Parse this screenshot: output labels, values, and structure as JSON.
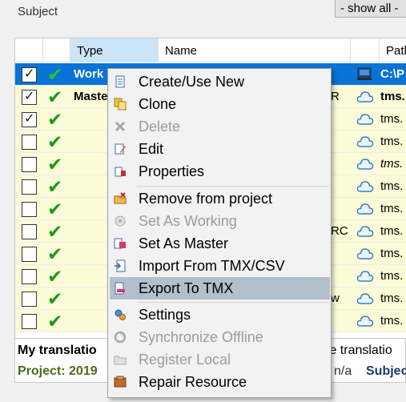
{
  "subject_label": "Subject",
  "show_all_label": "- show all -",
  "columns": {
    "type": "Type",
    "name": "Name",
    "path": "Path"
  },
  "rows": [
    {
      "checked": true,
      "type": "Work",
      "name": "",
      "path": "C:\\P",
      "selected": true,
      "location": "computer"
    },
    {
      "checked": true,
      "type": "Maste",
      "name": "R",
      "path": "tms.",
      "selected": false,
      "location": "cloud"
    },
    {
      "checked": true,
      "type": "",
      "name": "",
      "path": "tms.",
      "selected": false,
      "location": "cloud"
    },
    {
      "checked": false,
      "type": "",
      "name": "",
      "path": "tms.",
      "selected": false,
      "location": "cloud"
    },
    {
      "checked": false,
      "type": "",
      "name": "",
      "path": "tms.",
      "selected": false,
      "location": "cloud"
    },
    {
      "checked": false,
      "type": "",
      "name": "",
      "path": "tms.",
      "selected": false,
      "location": "cloud"
    },
    {
      "checked": false,
      "type": "",
      "name": "",
      "path": "tms.",
      "selected": false,
      "location": "cloud"
    },
    {
      "checked": false,
      "type": "",
      "name": "RC",
      "path": "tms.",
      "selected": false,
      "location": "cloud"
    },
    {
      "checked": false,
      "type": "",
      "name": "",
      "path": "tms.",
      "selected": false,
      "location": "cloud"
    },
    {
      "checked": false,
      "type": "",
      "name": "",
      "path": "tms.",
      "selected": false,
      "location": "cloud"
    },
    {
      "checked": false,
      "type": "",
      "name": "w",
      "path": "tms.",
      "selected": false,
      "location": "cloud"
    },
    {
      "checked": false,
      "type": "",
      "name": "",
      "path": "tms.",
      "selected": false,
      "location": "cloud"
    }
  ],
  "footer": {
    "title": "My translatio",
    "title_right": "gle translatio",
    "project": "Project: 2019",
    "value_right": "n/a",
    "subject_right": "Subjec"
  },
  "menu": {
    "items": [
      {
        "label": "Create/Use New",
        "icon": "document-icon",
        "disabled": false
      },
      {
        "label": "Clone",
        "icon": "clone-icon",
        "disabled": false
      },
      {
        "label": "Delete",
        "icon": "delete-icon",
        "disabled": true
      },
      {
        "label": "Edit",
        "icon": "edit-icon",
        "disabled": false
      },
      {
        "label": "Properties",
        "icon": "properties-icon",
        "disabled": false
      },
      {
        "label": "Remove from project",
        "icon": "remove-icon",
        "disabled": false
      },
      {
        "label": "Set As Working",
        "icon": "working-icon",
        "disabled": true
      },
      {
        "label": "Set As Master",
        "icon": "master-icon",
        "disabled": false
      },
      {
        "label": "Import From TMX/CSV",
        "icon": "import-icon",
        "disabled": false
      },
      {
        "label": "Export To TMX",
        "icon": "export-icon",
        "disabled": false,
        "highlighted": true
      },
      {
        "label": "Settings",
        "icon": "settings-icon",
        "disabled": false
      },
      {
        "label": "Synchronize Offline",
        "icon": "sync-icon",
        "disabled": true
      },
      {
        "label": "Register Local",
        "icon": "folder-icon",
        "disabled": true
      },
      {
        "label": "Repair Resource",
        "icon": "repair-icon",
        "disabled": false
      }
    ]
  }
}
